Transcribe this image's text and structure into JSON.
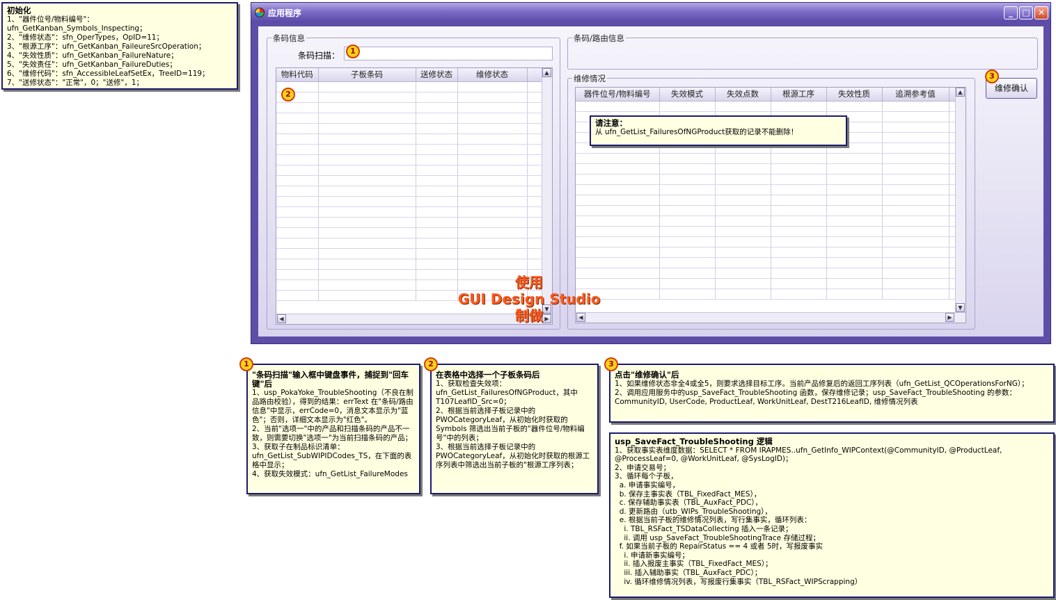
{
  "init_note": {
    "title": "初始化",
    "lines": [
      "1、\"器件位号/物料编号\"：ufn_GetKanban_Symbols_Inspecting；",
      "2、\"维修状态\"：sfn_OperTypes，OpID=11；",
      "3、\"根源工序\"：ufn_GetKanban_FaileureSrcOperation；",
      "4、\"失效性质\"：ufn_GetKanban_FailureNature；",
      "5、\"失效责任\"：ufn_GetKanban_FailureDuties；",
      "6、\"维修代码\"：sfn_AccessibleLeafSetEx，TreeID=119；",
      "7、\"送修状态\"：\"正常\"，0；\"送修\"，1；"
    ]
  },
  "window": {
    "title": "应用程序",
    "min_label": "_",
    "max_label": "□",
    "close_label": "✕"
  },
  "barcode_group": {
    "legend": "条码信息",
    "scan_label": "条码扫描：",
    "scan_value": "",
    "columns": [
      "物料代码",
      "子板条码",
      "送修状态",
      "维修状态"
    ]
  },
  "route_group": {
    "legend": "条码/路由信息"
  },
  "repair_group": {
    "legend": "维修情况",
    "columns": [
      "器件位号/物料编号",
      "失效模式",
      "失效点数",
      "根源工序",
      "失效性质",
      "追溯参考值"
    ]
  },
  "confirm_button": "维修确认",
  "tooltip": {
    "title": "请注意：",
    "text": "从 ufn_GetList_FailuresOfNGProduct获取的记录不能删除！"
  },
  "watermark": {
    "line1": "使用",
    "line2": "GUI Design Studio",
    "line3": "制做"
  },
  "badges": {
    "b1": "1",
    "b2": "2",
    "b3": "3"
  },
  "note1": {
    "title": "\"条码扫描\"输入框中键盘事件，捕捉到\"回车键\"后",
    "lines": [
      "1、usp_PokaYoke_TroubleShooting（不良在制品路由校验），得到的结果：errText 在\"条码/路由信息\"中显示，errCode=0，消息文本显示为\"蓝色\"；否则，详细文本显示为\"红色\"。",
      "2、当前\"选项一\"中的产品和扫描条码的产品不一致，则需要切换\"选项一\"为当前扫描条码的产品；",
      "3、获取子在制品标识清单：ufn_GetList_SubWIPIDCodes_TS，在下面的表格中显示；",
      "4、获取失效模式：ufn_GetList_FailureModes"
    ]
  },
  "note2": {
    "title": "在表格中选择一个子板条码后",
    "lines": [
      "1、获取检查失效项：ufn_GetList_FailuresOfNGProduct，其中T107LeafID_Src=0；",
      "2、根据当前选择子板记录中的PWOCategoryLeaf，从初始化时获取的Symbols 筛选出当前子板的\"器件位号/物料编号\"中的列表；",
      "3、根据当前选择子板记录中的PWOCategoryLeaf，从初始化时获取的根源工序列表中筛选出当前子板的\"根源工序列表；"
    ]
  },
  "note3": {
    "title": "点击\"维修确认\"后",
    "lines": [
      "1、如果维修状态非全4或全5，则要求选择目标工序。当前产品修复后的返回工序列表（ufn_GetList_QCOperationsForNG）；",
      "2、调用应用服务中的usp_SaveFact_TroubleShooting 函数，保存维修记录；usp_SaveFact_TroubleShooting 的参数：CommunityID, UserCode, ProductLeaf, WorkUnitLeaf, DestT216LeafID, 维修情况列表"
    ]
  },
  "note4": {
    "title": "usp_SaveFact_TroubleShooting 逻辑",
    "lines": [
      "1、获取事实表维度数据：SELECT * FROM IRAPMES..ufn_GetInfo_WIPContext(@CommunityID, @ProductLeaf, @ProcessLeaf=0, @WorkUnitLeaf, @SysLogID)；",
      "2、申请交易号；",
      "3、循环每个子板，",
      "  a. 申请事实编号，",
      "  b. 保存主事实表（TBL_FixedFact_MES），",
      "  c. 保存辅助事实表（TBL_AuxFact_PDC），",
      "  d. 更新路由（utb_WIPs_TroubleShooting），",
      "  e. 根据当前子板的维修情况列表，写行集事实，循环列表：",
      "    i. TBL_RSFact_TSDataCollecting 插入一条记录；",
      "    ii. 调用 usp_SaveFact_TroubleShootingTrace 存储过程；",
      "  f. 如果当前子板的 RepairStatus == 4 或者 5时，写报废事实",
      "    i. 申请新事实编号；",
      "    ii. 插入报废主事实（TBL_FixedFact_MES）；",
      "    iii. 插入辅助事实（TBL_AuxFact_PDC）；",
      "    iv. 循环维修情况列表，写报废行集事实（TBL_RSFact_WIPScrapping）"
    ]
  }
}
